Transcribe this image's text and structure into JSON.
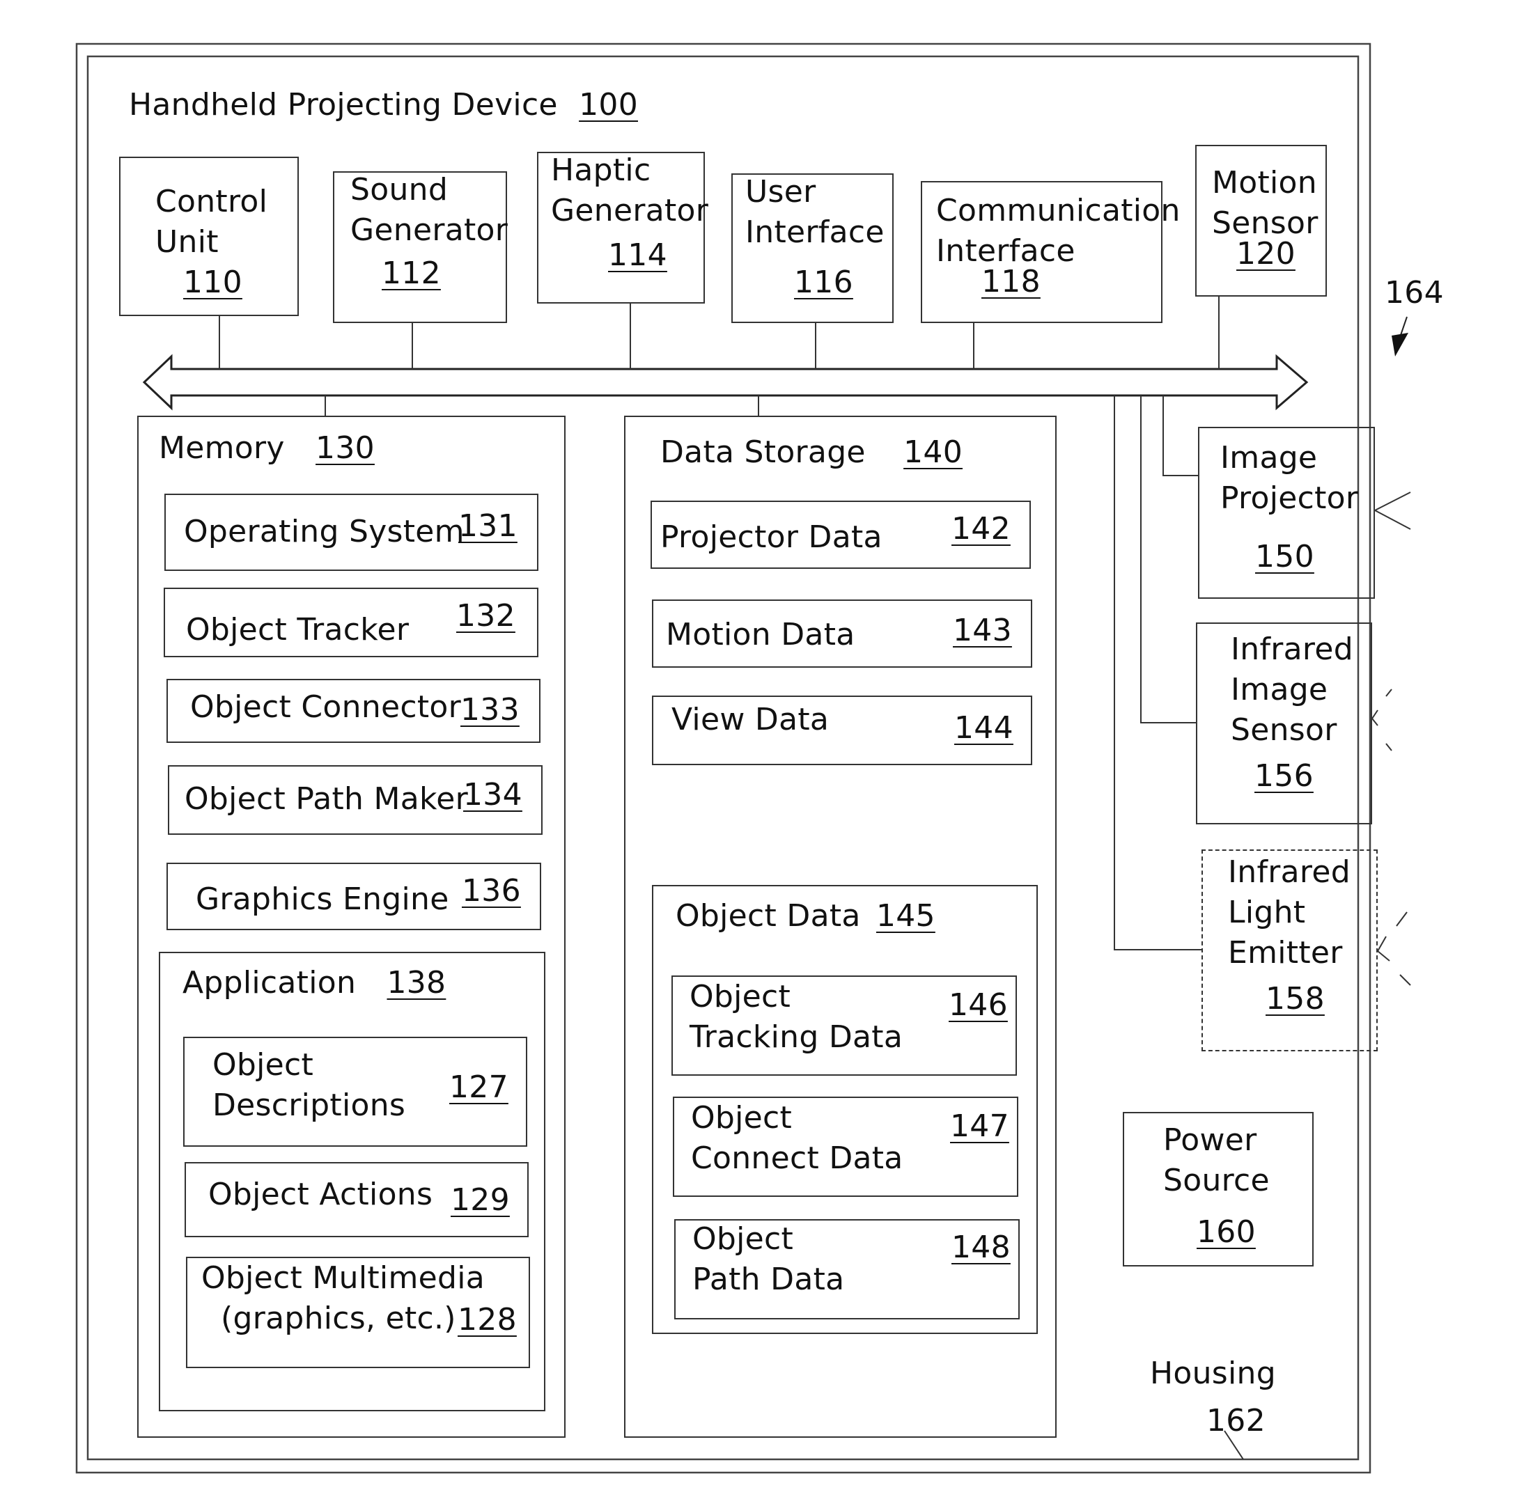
{
  "figure": {
    "title": "Handheld Projecting Device",
    "title_ref": "100",
    "housing_label": "Housing",
    "housing_ref": "162",
    "arrow_ref": "164"
  },
  "top_components": [
    {
      "lines": [
        "Control",
        "Unit"
      ],
      "ref": "110"
    },
    {
      "lines": [
        "Sound",
        "Generator"
      ],
      "ref": "112"
    },
    {
      "lines": [
        "Haptic",
        "Generator"
      ],
      "ref": "114"
    },
    {
      "lines": [
        "User",
        "Interface"
      ],
      "ref": "116"
    },
    {
      "lines": [
        "Communication",
        "Interface"
      ],
      "ref": "118"
    },
    {
      "lines": [
        "Motion",
        "Sensor"
      ],
      "ref": "120"
    }
  ],
  "memory": {
    "label": "Memory",
    "ref": "130",
    "items": [
      {
        "label": "Operating System",
        "ref": "131"
      },
      {
        "label": "Object Tracker",
        "ref": "132"
      },
      {
        "label": "Object Connector",
        "ref": "133"
      },
      {
        "label": "Object Path Maker",
        "ref": "134"
      },
      {
        "label": "Graphics Engine",
        "ref": "136"
      }
    ],
    "application": {
      "label": "Application",
      "ref": "138",
      "items": [
        {
          "lines": [
            "Object",
            "Descriptions"
          ],
          "ref": "127"
        },
        {
          "lines": [
            "Object Actions"
          ],
          "ref": "129"
        },
        {
          "lines": [
            "Object Multimedia",
            "(graphics, etc.)"
          ],
          "ref": "128"
        }
      ]
    }
  },
  "data_storage": {
    "label": "Data Storage",
    "ref": "140",
    "items": [
      {
        "label": "Projector Data",
        "ref": "142"
      },
      {
        "label": "Motion Data",
        "ref": "143"
      },
      {
        "label": "View Data",
        "ref": "144"
      }
    ],
    "object_data": {
      "label": "Object Data",
      "ref": "145",
      "items": [
        {
          "lines": [
            "Object",
            "Tracking Data"
          ],
          "ref": "146"
        },
        {
          "lines": [
            "Object",
            "Connect Data"
          ],
          "ref": "147"
        },
        {
          "lines": [
            "Object",
            "Path Data"
          ],
          "ref": "148"
        }
      ]
    }
  },
  "side_components": [
    {
      "lines": [
        "Image",
        "Projector"
      ],
      "ref": "150",
      "style": "solid"
    },
    {
      "lines": [
        "Infrared",
        "Image",
        "Sensor"
      ],
      "ref": "156",
      "style": "solid"
    },
    {
      "lines": [
        "Infrared",
        "Light",
        "Emitter"
      ],
      "ref": "158",
      "style": "dashed"
    }
  ],
  "power": {
    "lines": [
      "Power",
      "Source"
    ],
    "ref": "160"
  }
}
